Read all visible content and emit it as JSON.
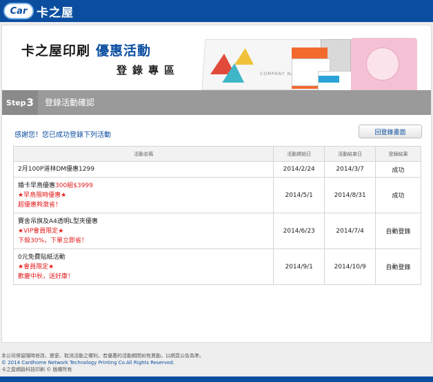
{
  "header": {
    "logo_badge": "Car",
    "logo_text": "卡之屋"
  },
  "banner": {
    "title": "卡之屋印刷",
    "title_highlight": "優惠活動",
    "subtitle": "登錄專區",
    "envelope_text": "COMPANY NAME"
  },
  "step": {
    "label": "Step",
    "number": "3",
    "title": "登錄活動確認"
  },
  "message": "感謝您！您已成功登錄下列活動",
  "back_button": "回登錄畫面",
  "table": {
    "headers": [
      "活動名稱",
      "活動開始日",
      "活動結束日",
      "登錄結果"
    ],
    "rows": [
      {
        "lines": [
          "2月100P道林DM優惠1299"
        ],
        "start": "2014/2/24",
        "end": "2014/3/7",
        "result": "成功"
      },
      {
        "line1a": "婚卡早鳥優惠",
        "line1b": "300組$3999",
        "line2": "★早鳥限時優惠★",
        "line3": "超優惠夠激省！",
        "start": "2014/5/1",
        "end": "2014/8/31",
        "result": "成功"
      },
      {
        "line1": "賽舍吊旗及A4透明L型夾優惠",
        "line2": "★VIP會員限定★",
        "line3": "下殺30%，下單立即省！",
        "start": "2014/6/23",
        "end": "2014/7/4",
        "result": "自動登錄"
      },
      {
        "line1": "0元免費貼紙活動",
        "line2": "★會員限定★",
        "line3": "歡慶中秋，送好康！",
        "start": "2014/9/1",
        "end": "2014/10/9",
        "result": "自動登錄"
      }
    ]
  },
  "footer": {
    "notice": "本公司保留隨時修改、變更、取消活動之權利，若優惠的活動期間如有異動，以網頁公告為準。",
    "copyright": "© 2014 Cardhome Network Technology Printing Co.All Rights Reserved.",
    "company": "卡之屋網路科技印刷 © 版權所有"
  }
}
